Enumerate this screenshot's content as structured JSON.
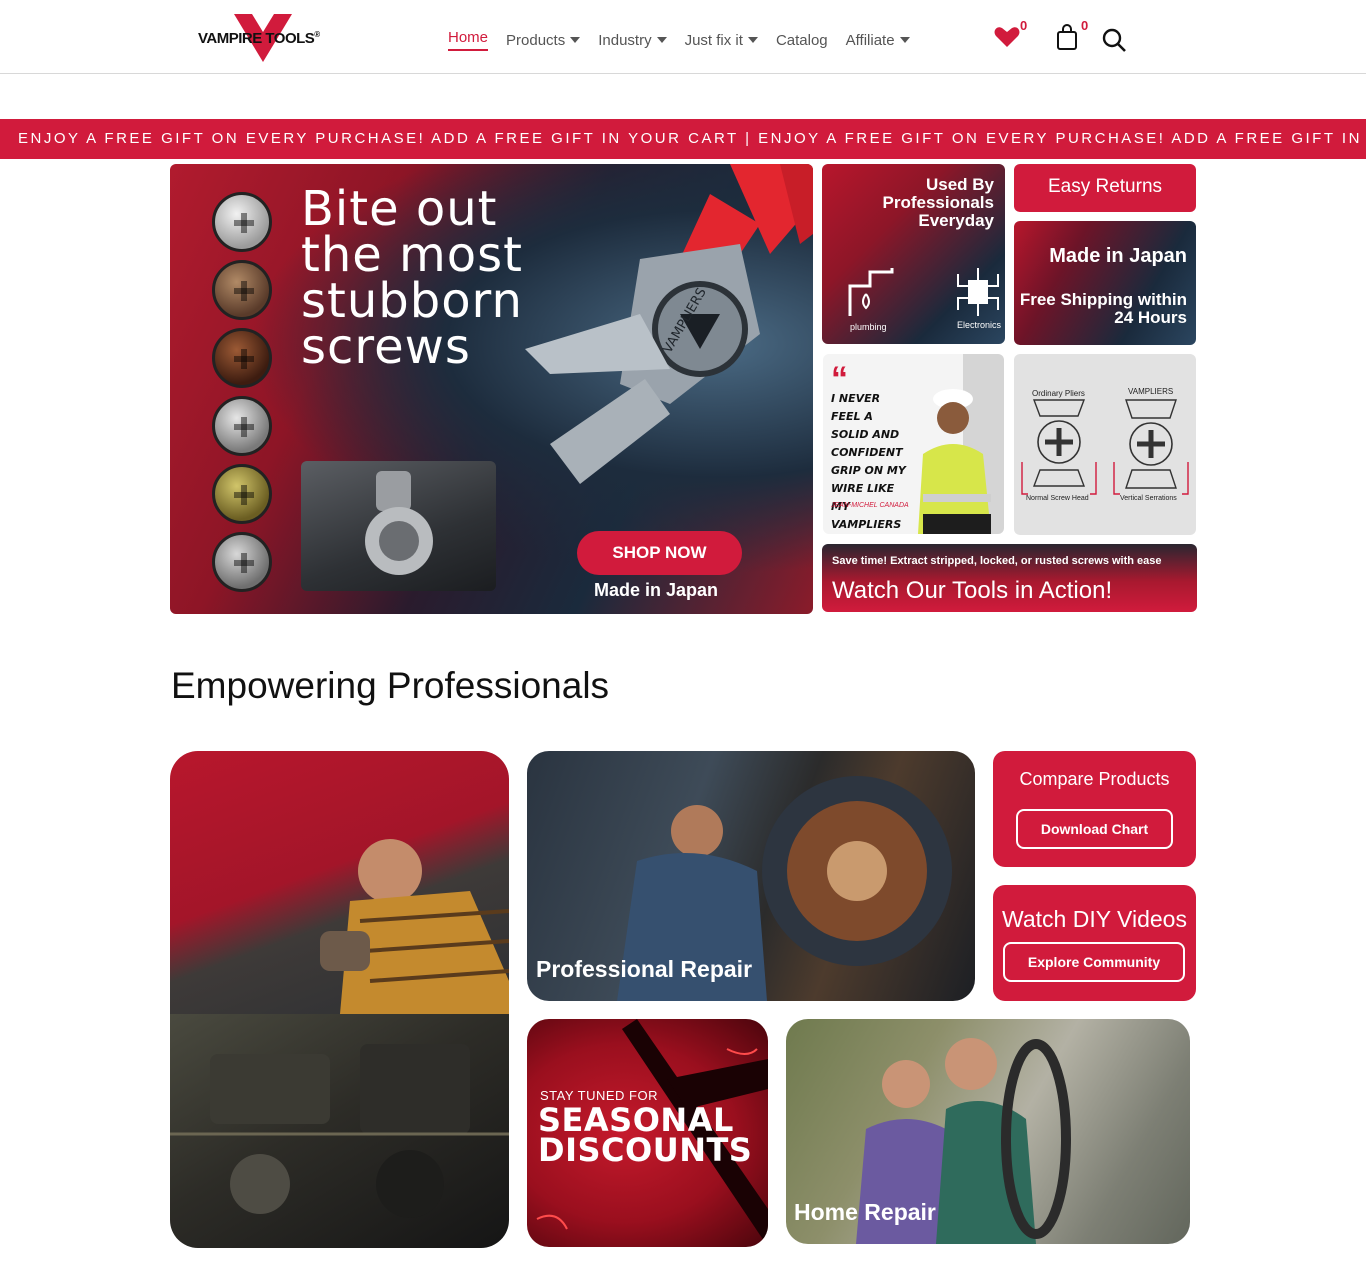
{
  "header": {
    "logo": {
      "text": "VAMPIRE TOOLS",
      "reg": "®"
    },
    "nav": [
      {
        "label": "Home",
        "active": true,
        "dropdown": false
      },
      {
        "label": "Products",
        "dropdown": true
      },
      {
        "label": "Industry",
        "dropdown": true
      },
      {
        "label": "Just fix it",
        "dropdown": true
      },
      {
        "label": "Catalog",
        "dropdown": false
      },
      {
        "label": "Affiliate",
        "dropdown": true
      }
    ],
    "wishlist_count": "0",
    "cart_count": "0",
    "icons": {
      "wishlist": "heart-icon",
      "cart": "bag-icon",
      "search": "search-icon"
    }
  },
  "promo": {
    "text": "ENJOY A FREE GIFT ON EVERY PURCHASE! ADD A FREE GIFT IN YOUR CART | ENJOY A FREE GIFT ON EVERY PURCHASE! ADD A FREE GIFT IN YOUR CART!"
  },
  "hero": {
    "title": "Bite out the most stubborn screws",
    "cta": "SHOP NOW",
    "subtext": "Made in Japan",
    "plier_brand": "VAMPLIERS"
  },
  "tiles": {
    "used_by": "Used By Professionals Everyday",
    "plumbing_label": "plumbing",
    "electronics_label": "Electronics",
    "easy_returns": "Easy Returns",
    "made_in_japan": "Made in Japan",
    "free_shipping": "Free Shipping within 24 Hours",
    "quote": "I NEVER FEEL A SOLID AND CONFIDENT GRIP ON MY WIRE LIKE MY VAMPLIERS",
    "quote_author": "JEAN-MICHEL CANADA",
    "compare_ordinary": "Ordinary Pliers",
    "compare_vampliers": "VAMPLIERS",
    "compare_normal": "Normal Screw Head",
    "compare_vertical": "Vertical Serrations",
    "watch_small": "Save time! Extract stripped, locked, or rusted screws with ease",
    "watch_big": "Watch Our Tools in Action!"
  },
  "section": {
    "title": "Empowering Professionals",
    "professional_repair": "Professional Repair",
    "compare_products": "Compare Products",
    "download_chart": "Download Chart",
    "watch_diy": "Watch DIY Videos",
    "explore_community": "Explore Community",
    "stay_tuned": "STAY TUNED FOR",
    "seasonal": "SEASONAL DISCOUNTS",
    "home_repair": "Home Repair"
  },
  "colors": {
    "brand": "#d11b3c",
    "text": "#111111",
    "nav": "#555555"
  }
}
